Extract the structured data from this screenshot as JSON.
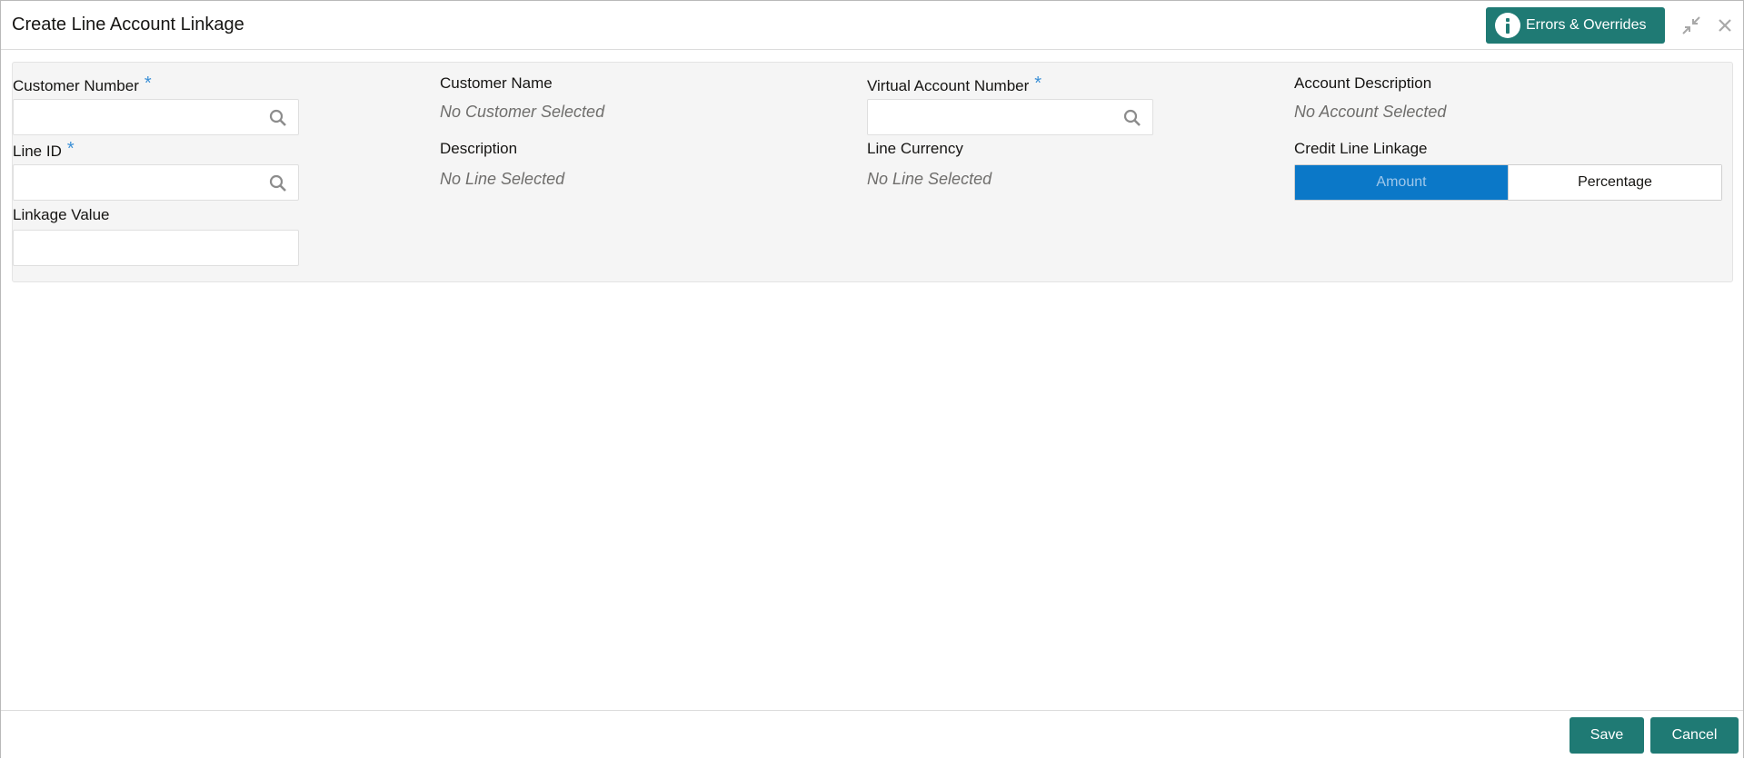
{
  "header": {
    "title": "Create Line Account Linkage",
    "errors_button_label": "Errors & Overrides"
  },
  "form": {
    "customer_number": {
      "label": "Customer Number",
      "required_mark": "*",
      "value": ""
    },
    "customer_name": {
      "label": "Customer Name",
      "value": "No Customer Selected"
    },
    "virtual_account_number": {
      "label": "Virtual Account Number",
      "required_mark": "*",
      "value": ""
    },
    "account_description": {
      "label": "Account Description",
      "value": "No Account Selected"
    },
    "line_id": {
      "label": "Line ID",
      "required_mark": "*",
      "value": ""
    },
    "description": {
      "label": "Description",
      "value": "No Line Selected"
    },
    "line_currency": {
      "label": "Line Currency",
      "value": "No Line Selected"
    },
    "credit_line_linkage": {
      "label": "Credit Line Linkage",
      "options": [
        "Amount",
        "Percentage"
      ],
      "selected": "Amount"
    },
    "linkage_value": {
      "label": "Linkage Value",
      "value": ""
    }
  },
  "footer": {
    "save_label": "Save",
    "cancel_label": "Cancel"
  },
  "colors": {
    "primary_button": "#1f7a74",
    "segment_active": "#0b78c8",
    "required_mark": "#3a8fd6"
  },
  "icons": {
    "info": "info-icon",
    "minimize": "minimize-icon",
    "close": "close-icon",
    "search": "search-icon"
  }
}
